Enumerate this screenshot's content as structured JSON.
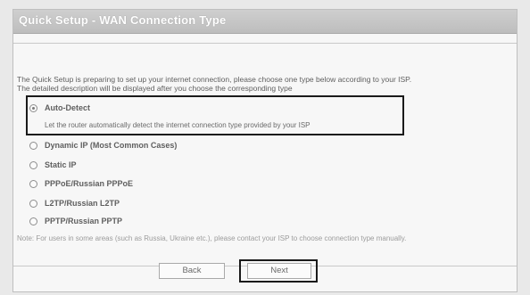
{
  "header": {
    "title": "Quick Setup - WAN Connection Type"
  },
  "intro": {
    "line1": "The Quick Setup is preparing to set up your internet connection, please choose one type below according to your ISP.",
    "line2": "The detailed description will be displayed after you choose the corresponding type"
  },
  "options": [
    {
      "label": "Auto-Detect",
      "checked": true,
      "description": "Let the router automatically detect the internet connection type provided by your ISP"
    },
    {
      "label": "Dynamic IP (Most Common Cases)",
      "checked": false
    },
    {
      "label": "Static IP",
      "checked": false
    },
    {
      "label": "PPPoE/Russian PPPoE",
      "checked": false
    },
    {
      "label": "L2TP/Russian L2TP",
      "checked": false
    },
    {
      "label": "PPTP/Russian PPTP",
      "checked": false
    }
  ],
  "note": "Note: For users in some areas (such as Russia, Ukraine etc.), please contact your ISP to choose connection type manually.",
  "buttons": {
    "back": "Back",
    "next": "Next"
  }
}
